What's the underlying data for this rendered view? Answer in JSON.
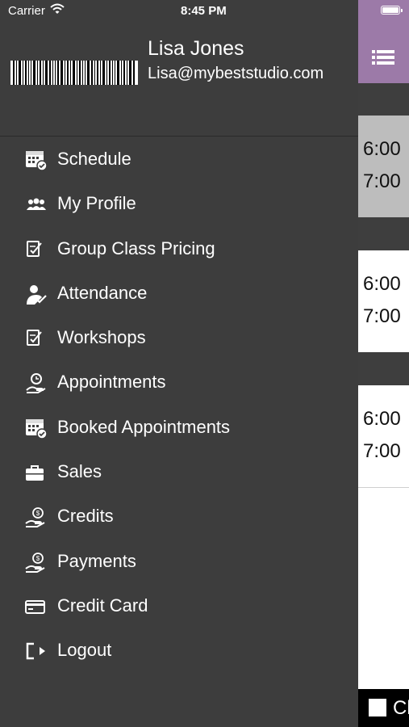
{
  "status": {
    "carrier": "Carrier",
    "time": "8:45 PM"
  },
  "user": {
    "name": "Lisa Jones",
    "email": "Lisa@mybeststudio.com"
  },
  "menu": [
    {
      "label": "Schedule",
      "icon": "calendar-check-icon"
    },
    {
      "label": "My Profile",
      "icon": "people-icon"
    },
    {
      "label": "Group Class Pricing",
      "icon": "signed-document-icon"
    },
    {
      "label": "Attendance",
      "icon": "person-check-icon"
    },
    {
      "label": "Workshops",
      "icon": "signed-document-icon"
    },
    {
      "label": "Appointments",
      "icon": "clock-hand-icon"
    },
    {
      "label": "Booked Appointments",
      "icon": "calendar-check-icon"
    },
    {
      "label": "Sales",
      "icon": "briefcase-icon"
    },
    {
      "label": "Credits",
      "icon": "hand-coin-icon"
    },
    {
      "label": "Payments",
      "icon": "hand-coin-icon"
    },
    {
      "label": "Credit Card",
      "icon": "credit-card-icon"
    },
    {
      "label": "Logout",
      "icon": "logout-icon"
    }
  ],
  "content": {
    "cards": [
      {
        "start": "6:00",
        "end": "7:00"
      },
      {
        "start": "6:00",
        "end": "7:00"
      },
      {
        "start": "6:00",
        "end": "7:00"
      }
    ],
    "bottom_text": "Cl"
  },
  "colors": {
    "drawer_bg": "#3d3d3d",
    "navbar_accent": "#9c7aa8",
    "selected_card": "#bdbdbd"
  }
}
